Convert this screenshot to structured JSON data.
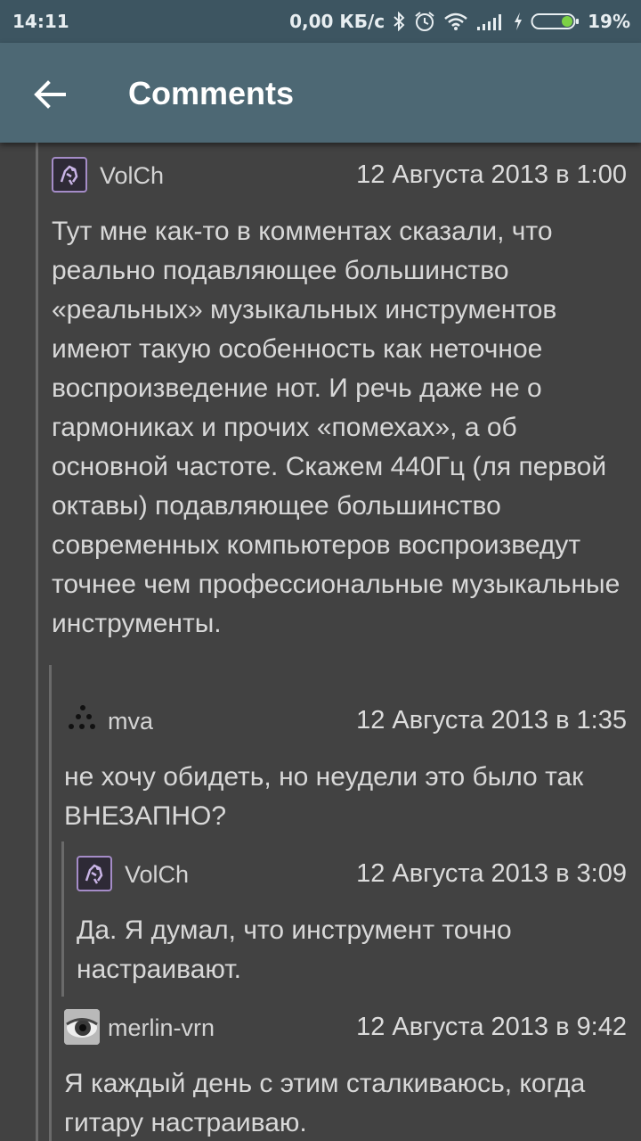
{
  "status_bar": {
    "time": "14:11",
    "network_speed": "0,00 КБ/с",
    "battery_percent": "19%",
    "icons": [
      "bluetooth-icon",
      "alarm-icon",
      "wifi-icon",
      "signal-icon",
      "charging-icon",
      "battery-icon"
    ]
  },
  "app_bar": {
    "title": "Comments",
    "back_icon": "arrow-left-icon"
  },
  "comments": [
    {
      "user": "VolCh",
      "date": "12 Августа 2013 в 1:00",
      "text": "Тут мне как-то в комментах сказали, что реально подавляющее большинство «реальных» музыкальных инструментов имеют такую особенность как неточное воспроизведение нот. И речь даже не о гармониках и прочих «помехах», а об основной частоте. Скажем 440Гц (ля первой октавы) подавляющее большинство современных компьютеров воспроизведут точнее чем профессиональные музыкальные инструменты."
    },
    {
      "user": "mva",
      "date": "12 Августа 2013 в 1:35",
      "text": "не хочу обидеть, но неудели это было так ВНЕЗАПНО?"
    },
    {
      "user": "VolCh",
      "date": "12 Августа 2013 в 3:09",
      "text": "Да. Я думал, что инструмент точно настраивают."
    },
    {
      "user": "merlin-vrn",
      "date": "12 Августа 2013 в 9:42",
      "text": "Я каждый день с этим сталкиваюсь, когда гитару настраиваю."
    }
  ],
  "colors": {
    "status_bar": "#3d5561",
    "app_bar": "#4d6874",
    "background": "#424242",
    "text": "#d8d8d8",
    "thread_line": "#6a6a6a"
  }
}
